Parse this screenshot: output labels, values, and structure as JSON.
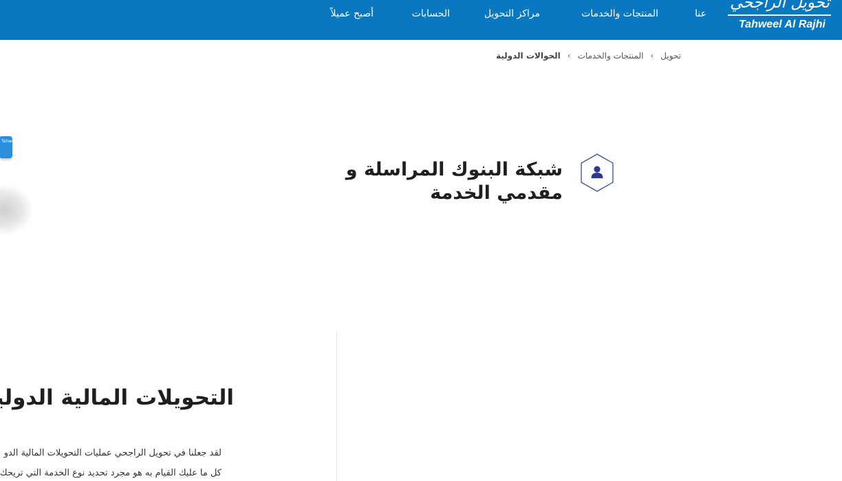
{
  "header": {
    "logo_ar": "تحويل الراجحي",
    "logo_en": "Tahweel Al Rajhi",
    "nav": [
      {
        "label": "عنا"
      },
      {
        "label": "المنتجات والخدمات"
      },
      {
        "label": "مراكز التحويل"
      },
      {
        "label": "الحسابات"
      },
      {
        "label": "أصبح عميلاً"
      }
    ]
  },
  "breadcrumb": {
    "items": [
      "تحويل",
      "المنتجات والخدمات",
      "الحوالات الدولية"
    ],
    "separator": "›"
  },
  "decor": {
    "card_text": "Tahweel"
  },
  "section": {
    "icon": "user-hexagon-icon",
    "title": "شبكة البنوك المراسلة و مقدمي الخدمة"
  },
  "intl": {
    "title": "التحويلات المالية الدولية",
    "paragraph_lines": [
      "لقد جعلنا في تحويل الراجحي عمليات التحويلات المالية الدو",
      "كل ما عليك القيام به هو مجرد تحديد نوع الخدمة التي تريحك"
    ]
  },
  "colors": {
    "brand": "#0a78c0",
    "icon_stroke": "#3a4aa0"
  }
}
